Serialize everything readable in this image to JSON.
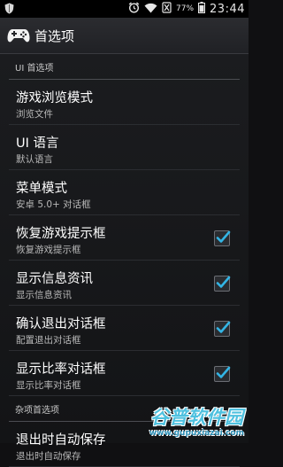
{
  "status_bar": {
    "battery": "77%",
    "time": "23:44"
  },
  "action_bar": {
    "icon": "gamepad-icon",
    "title": "首选项"
  },
  "sections": [
    {
      "header": "UI 首选项",
      "items": [
        {
          "title": "游戏浏览模式",
          "summary": "浏览文件",
          "checkbox": null
        },
        {
          "title": "UI 语言",
          "summary": "默认语言",
          "checkbox": null
        },
        {
          "title": "菜单模式",
          "summary": "安卓 5.0+ 对话框",
          "checkbox": null
        },
        {
          "title": "恢复游戏提示框",
          "summary": "恢复游戏提示框",
          "checkbox": true
        },
        {
          "title": "显示信息资讯",
          "summary": "显示信息资讯",
          "checkbox": true
        },
        {
          "title": "确认退出对话框",
          "summary": "配置退出对话框",
          "checkbox": true
        },
        {
          "title": "显示比率对话框",
          "summary": "显示比率对话框",
          "checkbox": true
        }
      ]
    },
    {
      "header": "杂项首选项",
      "items": [
        {
          "title": "退出时自动保存",
          "summary": "退出时自动保存",
          "checkbox": null
        }
      ]
    }
  ],
  "watermark": {
    "brand": "谷普软件园",
    "url": "www.gupuxiazai.com"
  },
  "colors": {
    "accent_check": "#33b5e5",
    "status_bar_bg": "#000000",
    "action_bar_bg": "#25262a"
  }
}
